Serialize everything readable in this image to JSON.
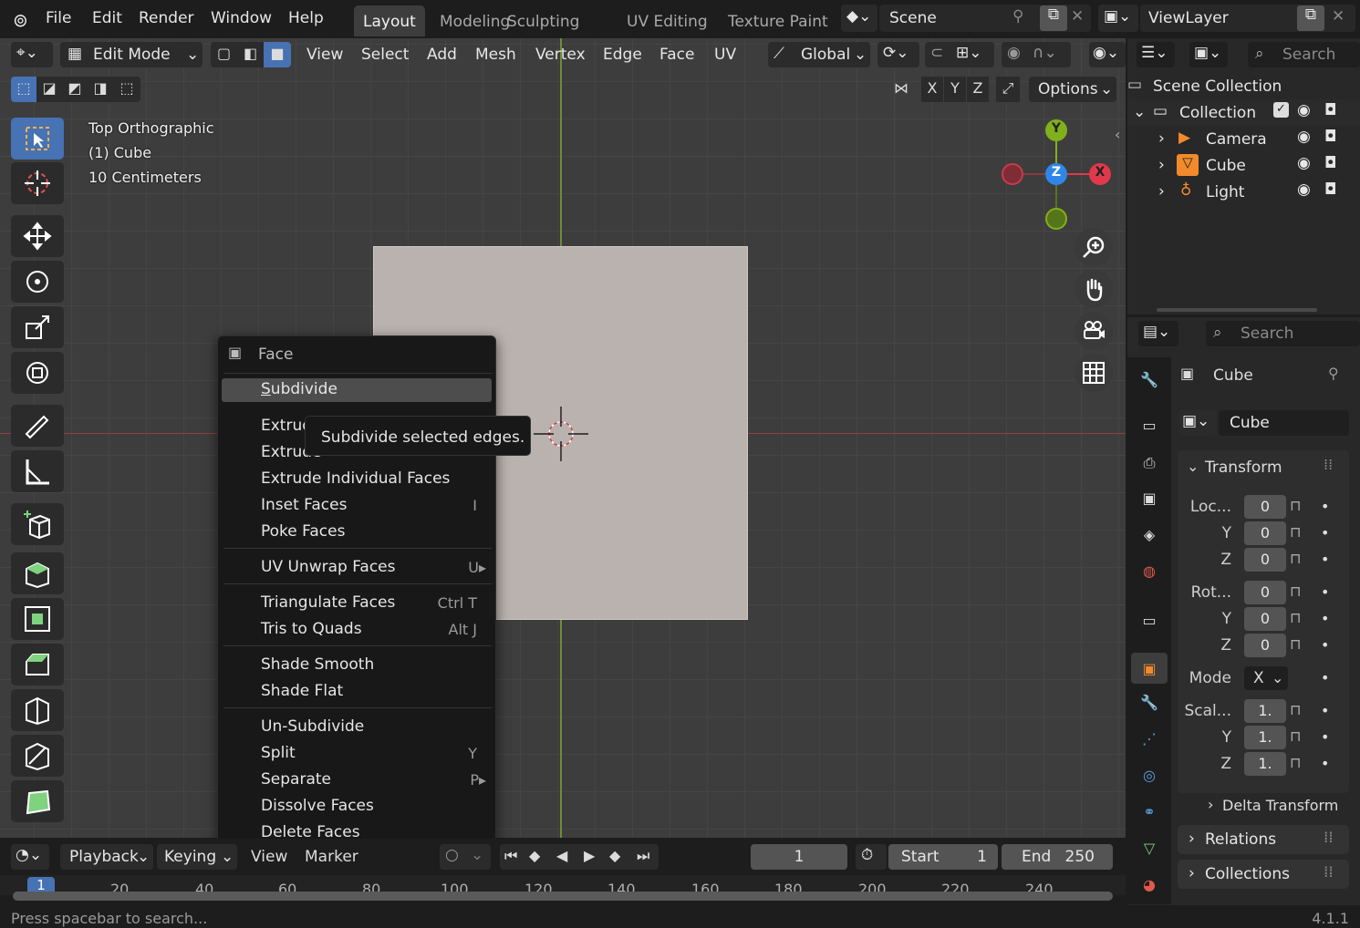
{
  "topbar": {
    "menus": [
      "File",
      "Edit",
      "Render",
      "Window",
      "Help"
    ],
    "workspaces": [
      "Layout",
      "Modeling",
      "Sculpting",
      "UV Editing",
      "Texture Paint"
    ],
    "active_workspace": "Layout",
    "scene": "Scene",
    "view_layer": "ViewLayer"
  },
  "viewport_header": {
    "mode": "Edit Mode",
    "menus": [
      "View",
      "Select",
      "Add",
      "Mesh",
      "Vertex",
      "Edge",
      "Face",
      "UV"
    ],
    "orientation": "Global",
    "options_label": "Options",
    "axes": [
      "X",
      "Y",
      "Z"
    ]
  },
  "viewport_info": {
    "view_name": "Top Orthographic",
    "object": "(1) Cube",
    "scale": "10 Centimeters"
  },
  "gizmo": {
    "y": "Y",
    "z": "Z",
    "x": "X"
  },
  "context_menu": {
    "title": "Face",
    "items": [
      {
        "label": "Subdivide",
        "shortcut": ""
      },
      {
        "label": "Extrude",
        "shortcut": ""
      },
      {
        "label": "Extrude",
        "shortcut": ""
      },
      {
        "label": "Extrude Individual Faces",
        "shortcut": ""
      },
      {
        "label": "Inset Faces",
        "shortcut": "I"
      },
      {
        "label": "Poke Faces",
        "shortcut": ""
      },
      {
        "label": "UV Unwrap Faces",
        "shortcut": "U▸"
      },
      {
        "label": "Triangulate Faces",
        "shortcut": "Ctrl T"
      },
      {
        "label": "Tris to Quads",
        "shortcut": "Alt J"
      },
      {
        "label": "Shade Smooth",
        "shortcut": ""
      },
      {
        "label": "Shade Flat",
        "shortcut": ""
      },
      {
        "label": "Un-Subdivide",
        "shortcut": ""
      },
      {
        "label": "Split",
        "shortcut": "Y"
      },
      {
        "label": "Separate",
        "shortcut": "P▸"
      },
      {
        "label": "Dissolve Faces",
        "shortcut": ""
      },
      {
        "label": "Delete Faces",
        "shortcut": ""
      }
    ]
  },
  "tooltip": "Subdivide selected edges.",
  "outliner": {
    "search_placeholder": "Search",
    "root": "Scene Collection",
    "collection": "Collection",
    "objects": [
      "Camera",
      "Cube",
      "Light"
    ]
  },
  "properties": {
    "search_placeholder": "Search",
    "object_name": "Cube",
    "data_name": "Cube",
    "transform_title": "Transform",
    "location_label": "Loc...",
    "rotation_label": "Rot...",
    "scale_label": "Scal...",
    "mode_label": "Mode",
    "mode_value": "X",
    "axis_y": "Y",
    "axis_z": "Z",
    "location": [
      "0",
      "0",
      "0"
    ],
    "rotation": [
      "0",
      "0",
      "0"
    ],
    "scale": [
      "1.",
      "1.",
      "1."
    ],
    "delta_transform": "Delta Transform",
    "relations": "Relations",
    "collections": "Collections"
  },
  "timeline": {
    "playback": "Playback",
    "keying": "Keying",
    "view": "View",
    "marker": "Marker",
    "current_frame": "1",
    "start_label": "Start",
    "start": "1",
    "end_label": "End",
    "end": "250",
    "ruler": [
      "1",
      "20",
      "40",
      "60",
      "80",
      "100",
      "120",
      "140",
      "160",
      "180",
      "200",
      "220",
      "240"
    ]
  },
  "status": {
    "hint": "Press spacebar to search...",
    "version": "4.1.1"
  },
  "colors": {
    "accent": "#4772b3",
    "axis_x": "#e2384c",
    "axis_y": "#80b01c",
    "axis_z": "#2f86e8",
    "active_object": "#f28a2b"
  }
}
